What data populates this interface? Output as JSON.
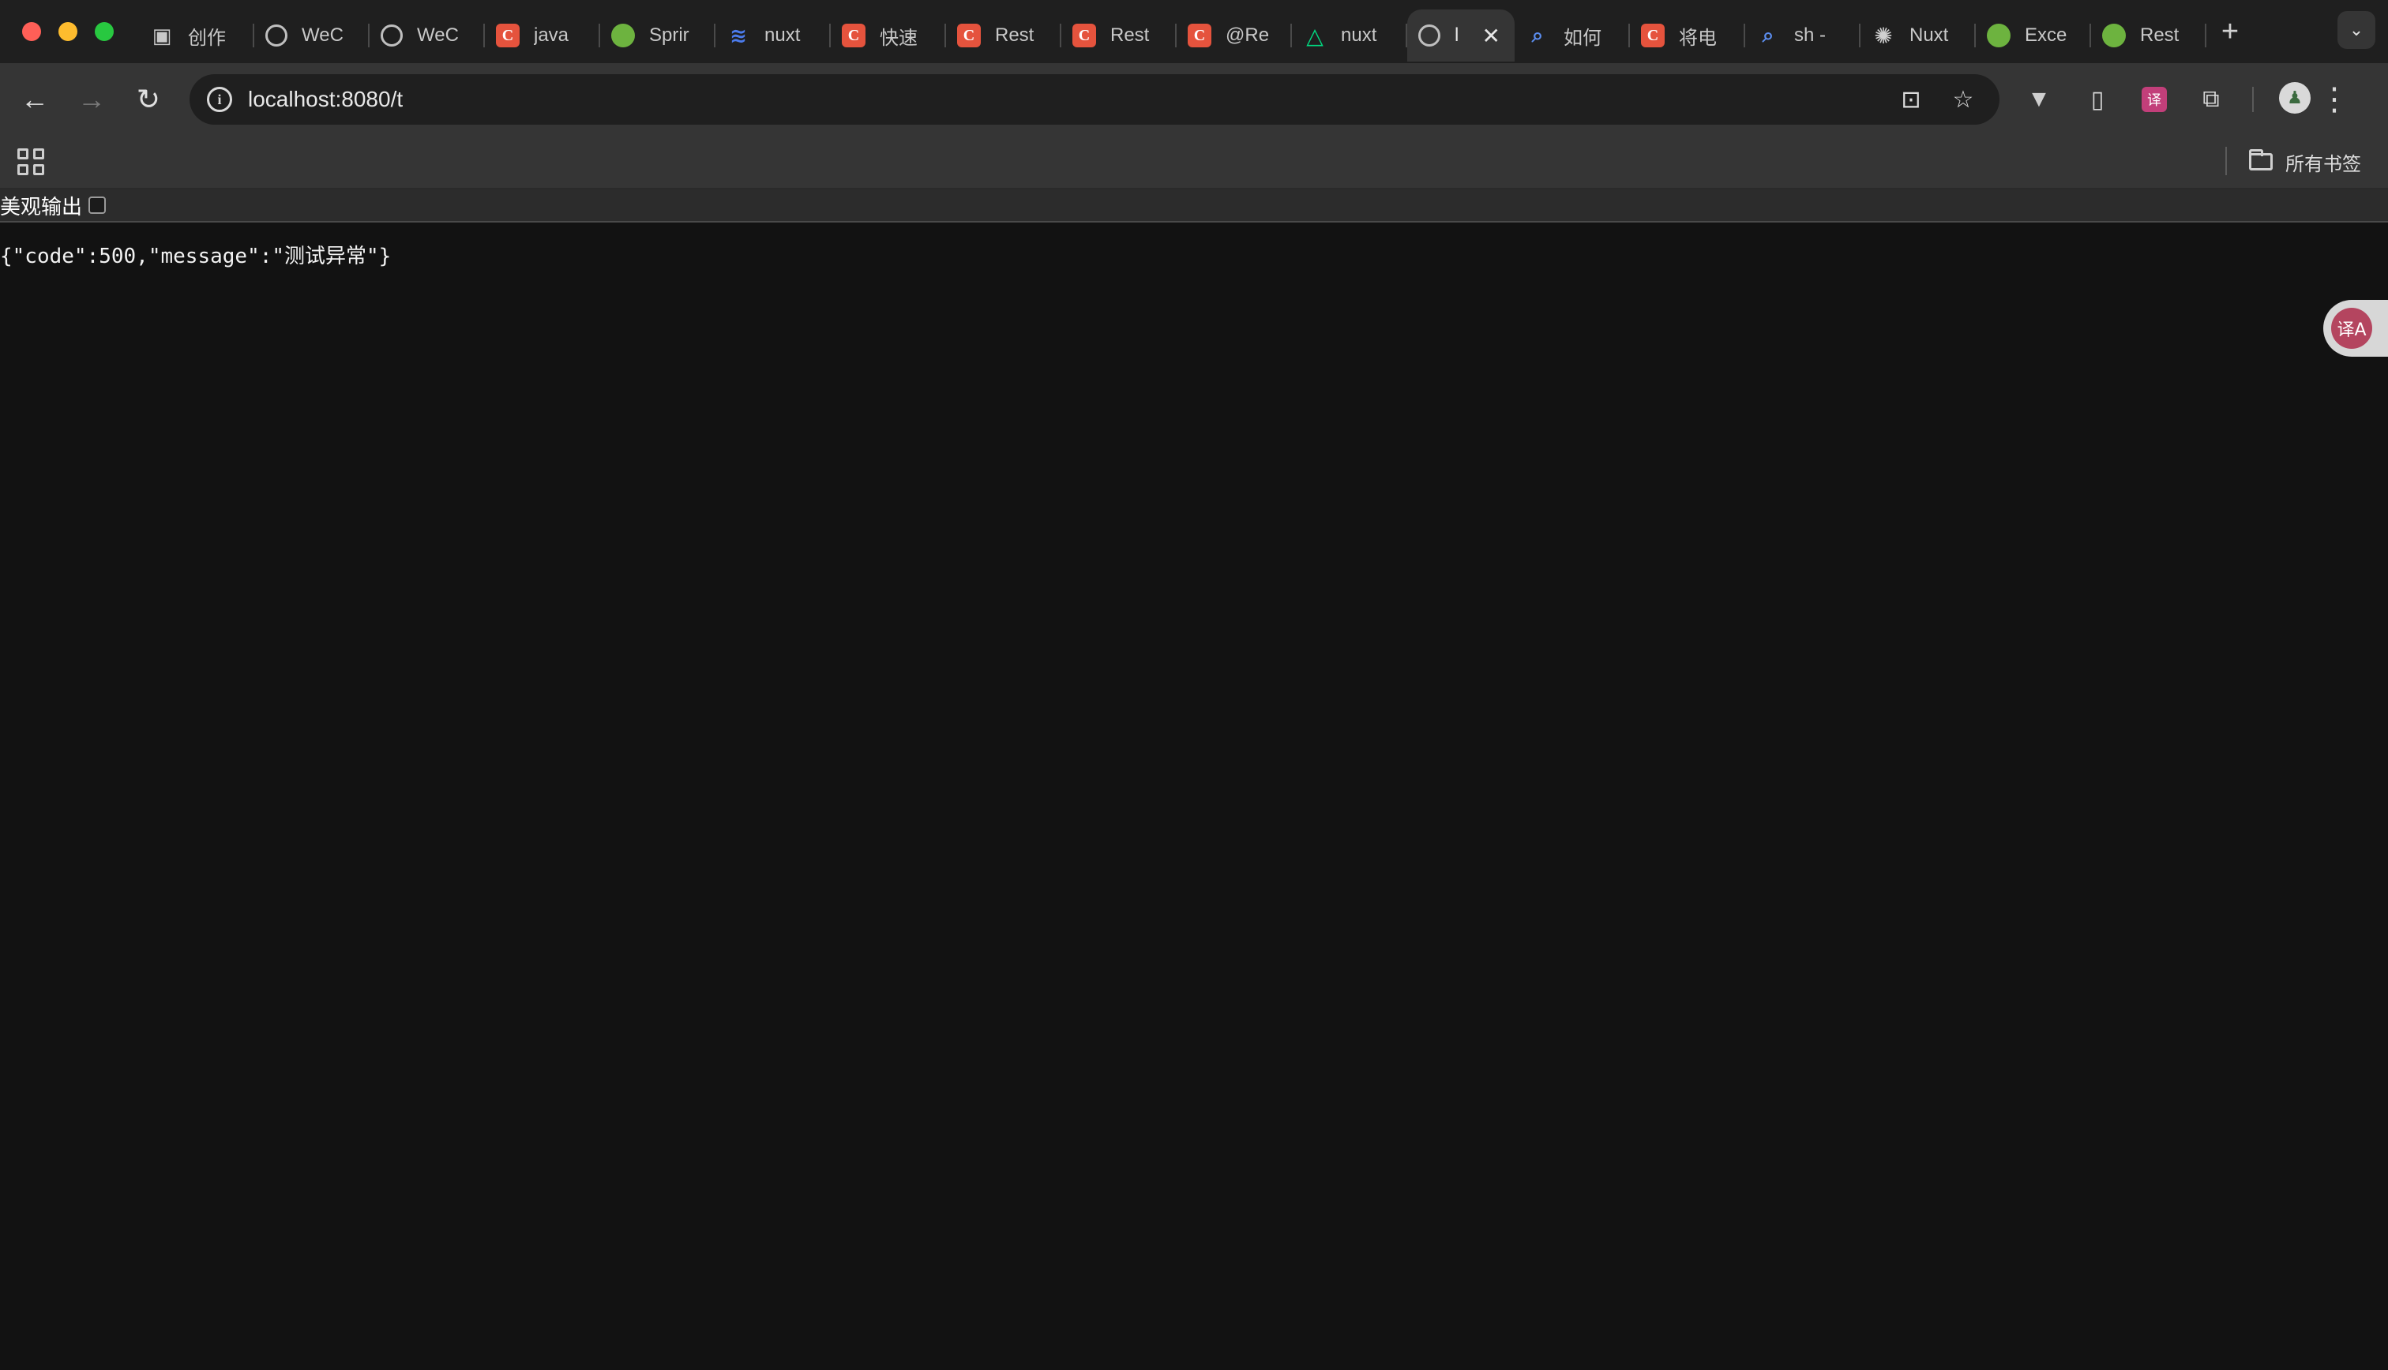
{
  "window": {
    "controls": [
      "close",
      "minimize",
      "zoom"
    ]
  },
  "tabs": [
    {
      "title": "创作",
      "favicon": "robot-icon"
    },
    {
      "title": "WeC",
      "favicon": "globe-icon"
    },
    {
      "title": "WeC",
      "favicon": "globe-icon"
    },
    {
      "title": "java",
      "favicon": "csdn-icon"
    },
    {
      "title": "Sprir",
      "favicon": "spring-icon"
    },
    {
      "title": "nuxt",
      "favicon": "layers-icon"
    },
    {
      "title": "快速",
      "favicon": "csdn-icon"
    },
    {
      "title": "Rest",
      "favicon": "csdn-icon"
    },
    {
      "title": "Rest",
      "favicon": "csdn-icon"
    },
    {
      "title": "@Re",
      "favicon": "csdn-icon"
    },
    {
      "title": "nuxt",
      "favicon": "nuxt-icon"
    },
    {
      "title": "l",
      "favicon": "globe-icon",
      "active": true
    },
    {
      "title": "如何",
      "favicon": "search-icon"
    },
    {
      "title": "将电",
      "favicon": "csdn-icon"
    },
    {
      "title": "sh -",
      "favicon": "search-icon"
    },
    {
      "title": "Nuxt",
      "favicon": "openai-icon"
    },
    {
      "title": "Exce",
      "favicon": "spring-icon"
    },
    {
      "title": "Rest",
      "favicon": "spring-icon"
    }
  ],
  "tab_icons": {
    "csdn": "C",
    "new_tab": "+",
    "close": "✕",
    "tab_search": "⌄"
  },
  "toolbar": {
    "back": "←",
    "forward": "→",
    "reload": "↻",
    "url": "localhost:8080/t",
    "info": "i",
    "translate": "⊡",
    "bookmark_star": "☆",
    "menu": "⋮"
  },
  "extensions": {
    "vue_devtools": "▼",
    "device": "▯",
    "translate_ext": "译",
    "puzzle": "⧉"
  },
  "bookmarks_bar": {
    "all_bookmarks": "所有书签"
  },
  "page": {
    "pretty_print_label": "美观输出",
    "pretty_print_checked": false,
    "json_text": "{\"code\":500,\"message\":\"测试异常\"}",
    "floating_translate": "译A"
  },
  "colors": {
    "tabstrip_bg": "#1f1f1f",
    "toolbar_bg": "#353535",
    "page_bg": "#121212",
    "csdn_red": "#e5533d",
    "spring_green": "#6db33f",
    "nuxt_green": "#00dc82"
  }
}
